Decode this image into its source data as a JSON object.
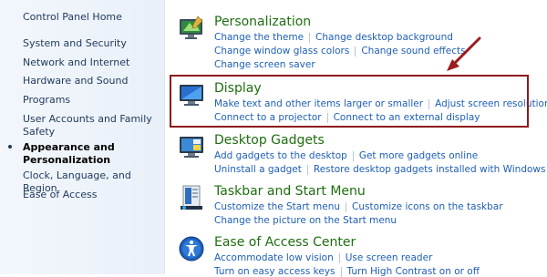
{
  "sidebar": {
    "home": "Control Panel Home",
    "items": [
      {
        "label": "System and Security"
      },
      {
        "label": "Network and Internet"
      },
      {
        "label": "Hardware and Sound"
      },
      {
        "label": "Programs"
      },
      {
        "label": "User Accounts and Family"
      },
      {
        "label": "Safety"
      },
      {
        "label": "Appearance and"
      },
      {
        "label": "Personalization"
      },
      {
        "label": "Clock, Language, and Region"
      },
      {
        "label": "Ease of Access"
      }
    ]
  },
  "categories": [
    {
      "title": "Personalization",
      "lines": [
        [
          "Change the theme",
          "Change desktop background"
        ],
        [
          "Change window glass colors",
          "Change sound effects"
        ],
        [
          "Change screen saver"
        ]
      ]
    },
    {
      "title": "Display",
      "lines": [
        [
          "Make text and other items larger or smaller",
          "Adjust screen resolution"
        ],
        [
          "Connect to a projector",
          "Connect to an external display"
        ]
      ]
    },
    {
      "title": "Desktop Gadgets",
      "lines": [
        [
          "Add gadgets to the desktop",
          "Get more gadgets online"
        ],
        [
          "Uninstall a gadget",
          "Restore desktop gadgets installed with Windows"
        ]
      ]
    },
    {
      "title": "Taskbar and Start Menu",
      "lines": [
        [
          "Customize the Start menu",
          "Customize icons on the taskbar"
        ],
        [
          "Change the picture on the Start menu"
        ]
      ]
    },
    {
      "title": "Ease of Access Center",
      "lines": [
        [
          "Accommodate low vision",
          "Use screen reader"
        ],
        [
          "Turn on easy access keys",
          "Turn High Contrast on or off"
        ]
      ]
    }
  ]
}
